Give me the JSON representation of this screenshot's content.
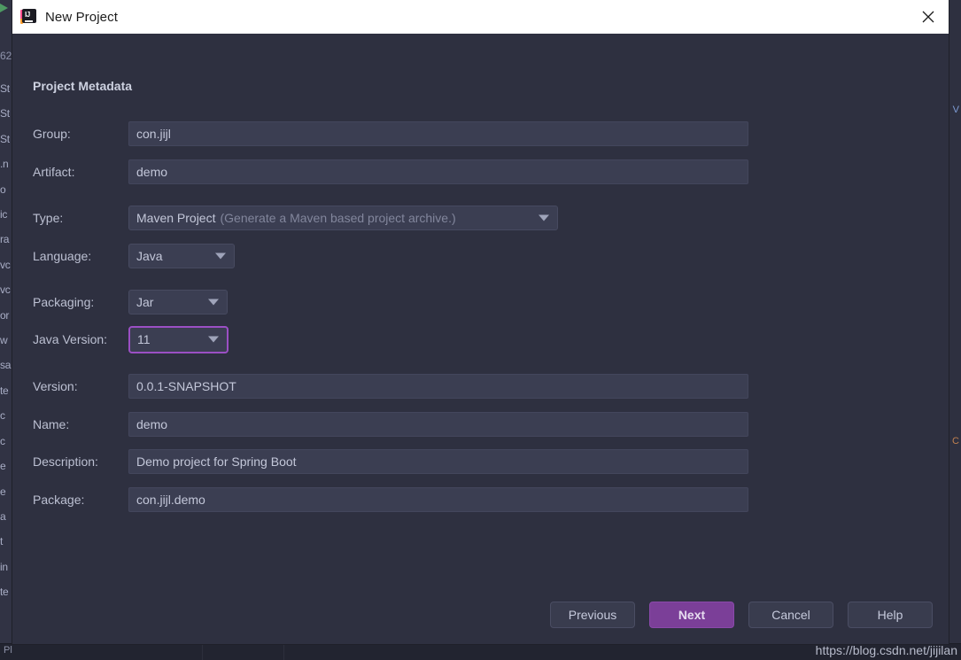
{
  "ide": {
    "left_fragments": "St\nSt\nSt\n.n\no\nic\nra\nvc\nvc\nor\nw\nsa\nte\nc\nc\ne\ne\na\nt\nin\nte",
    "top_line_number": "62",
    "status_text": "Pl",
    "right_marks": {
      "top": "V",
      "bottom": "C"
    }
  },
  "window": {
    "title": "New Project",
    "icon": "intellij-idea-icon",
    "ij_letters": "IJ",
    "close_icon": "close-icon"
  },
  "form": {
    "section_title": "Project Metadata",
    "fields": [
      {
        "label": "Group:",
        "value": "con.jijl",
        "kind": "text"
      },
      {
        "label": "Artifact:",
        "value": "demo",
        "kind": "text"
      },
      {
        "label": "Type:",
        "value": "Maven Project",
        "hint": "(Generate a Maven based project archive.)",
        "kind": "combo"
      },
      {
        "label": "Language:",
        "value": "Java",
        "kind": "combo"
      },
      {
        "label": "Packaging:",
        "value": "Jar",
        "kind": "combo"
      },
      {
        "label": "Java Version:",
        "value": "11",
        "kind": "combo",
        "focused": true
      },
      {
        "label": "Version:",
        "value": "0.0.1-SNAPSHOT",
        "kind": "text"
      },
      {
        "label": "Name:",
        "value": "demo",
        "kind": "text"
      },
      {
        "label": "Description:",
        "value": "Demo project for Spring Boot",
        "kind": "text"
      },
      {
        "label": "Package:",
        "value": "con.jijl.demo",
        "kind": "text"
      }
    ]
  },
  "footer": {
    "buttons": [
      {
        "label": "Previous",
        "primary": false
      },
      {
        "label": "Next",
        "primary": true
      },
      {
        "label": "Cancel",
        "primary": false
      },
      {
        "label": "Help",
        "primary": false
      }
    ]
  },
  "watermark": {
    "text": "https://blog.csdn.net/jijilan"
  },
  "colors": {
    "dialog_bg": "#2e3040",
    "field_bg": "#3b3e52",
    "accent_purple": "#7b3f98",
    "focus_purple": "#9b4fc4",
    "label_text": "#bcc0d2",
    "titlebar_bg": "#ffffff"
  }
}
